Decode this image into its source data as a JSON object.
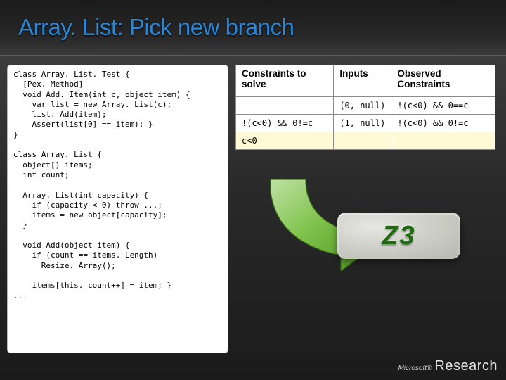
{
  "title": "Array. List: Pick new branch",
  "code": "class Array. List. Test {\n  [Pex. Method]\n  void Add. Item(int c, object item) {\n    var list = new Array. List(c);\n    list. Add(item);\n    Assert(list[0] == item); }\n}\n\nclass Array. List {\n  object[] items;\n  int count;\n\n  Array. List(int capacity) {\n    if (capacity < 0) throw ...;\n    items = new object[capacity];\n  }\n\n  void Add(object item) {\n    if (count == items. Length)\n      Resize. Array();\n\n    items[this. count++] = item; }\n...",
  "table": {
    "headers": [
      "Constraints to solve",
      "Inputs",
      "Observed Constraints"
    ],
    "rows": [
      {
        "c0": "",
        "c1": "(0, null)",
        "c2": "!(c<0) && 0==c"
      },
      {
        "c0": "!(c<0) && 0!=c",
        "c1": "(1, null)",
        "c2": "!(c<0) && 0!=c"
      },
      {
        "c0": "c<0",
        "c1": "",
        "c2": ""
      }
    ],
    "highlight_row": 2
  },
  "logo_text": "Z3",
  "brand": {
    "ms": "Microsoft®",
    "research": "Research"
  }
}
